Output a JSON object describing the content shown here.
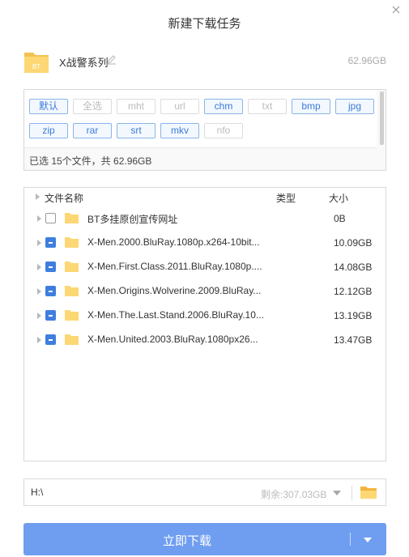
{
  "dialog": {
    "title": "新建下载任务"
  },
  "torrent": {
    "badge": "BT",
    "name": "X战警系列",
    "size": "62.96GB"
  },
  "filters": {
    "chips": [
      {
        "label": "默认",
        "active": true
      },
      {
        "label": "全选",
        "active": false
      },
      {
        "label": "mht",
        "active": false
      },
      {
        "label": "url",
        "active": false
      },
      {
        "label": "chm",
        "active": true
      },
      {
        "label": "txt",
        "active": false
      },
      {
        "label": "bmp",
        "active": true
      },
      {
        "label": "jpg",
        "active": true
      },
      {
        "label": "zip",
        "active": true
      },
      {
        "label": "rar",
        "active": true
      },
      {
        "label": "srt",
        "active": true
      },
      {
        "label": "mkv",
        "active": true
      },
      {
        "label": "nfo",
        "active": false
      }
    ],
    "summary": "已选 15个文件，共 62.96GB"
  },
  "file_list": {
    "columns": {
      "name": "文件名称",
      "type": "类型",
      "size": "大小"
    },
    "rows": [
      {
        "name": "BT多挂原创宣传网址",
        "size": "0B",
        "checked": false
      },
      {
        "name": "X-Men.2000.BluRay.1080p.x264-10bit...",
        "size": "10.09GB",
        "checked": true
      },
      {
        "name": "X-Men.First.Class.2011.BluRay.1080p....",
        "size": "14.08GB",
        "checked": true
      },
      {
        "name": "X-Men.Origins.Wolverine.2009.BluRay...",
        "size": "12.12GB",
        "checked": true
      },
      {
        "name": "X-Men.The.Last.Stand.2006.BluRay.10...",
        "size": "13.19GB",
        "checked": true
      },
      {
        "name": "X-Men.United.2003.BluRay.1080px26...",
        "size": "13.47GB",
        "checked": true
      }
    ]
  },
  "save_path": {
    "value": "H:\\",
    "free_space": "剩余:307.03GB"
  },
  "download_button": {
    "label": "立即下载"
  },
  "colors": {
    "accent": "#3f7ede",
    "button": "#6f9ef0",
    "folder": "#fcd774",
    "chip_border": "#8ab4e8"
  }
}
